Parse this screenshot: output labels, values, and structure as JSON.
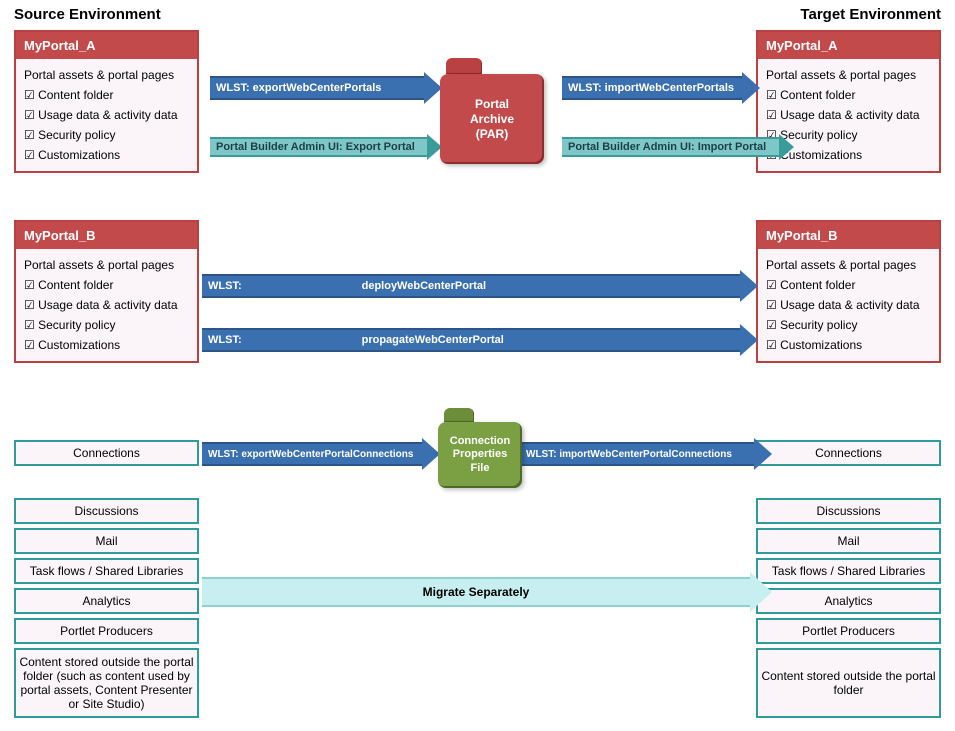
{
  "titles": {
    "source": "Source Environment",
    "target": "Target Environment"
  },
  "portals": {
    "a": {
      "name": "MyPortal_A",
      "items": [
        "Portal assets & portal pages",
        "☑ Content folder",
        "☑ Usage data & activity data",
        "☑ Security policy",
        "☑ Customizations"
      ]
    },
    "b": {
      "name": "MyPortal_B",
      "items": [
        "Portal assets & portal pages",
        "☑ Content folder",
        "☑ Usage data & activity data",
        "☑ Security policy",
        "☑ Customizations"
      ]
    }
  },
  "arrows": {
    "exportPortals": "WLST: exportWebCenterPortals",
    "importPortals": "WLST: importWebCenterPortals",
    "exportUI": "Portal Builder Admin UI: Export Portal",
    "importUI": "Portal Builder Admin UI: Import Portal",
    "deploy_prefix": "WLST:",
    "deploy_cmd": "deployWebCenterPortal",
    "propagate_prefix": "WLST:",
    "propagate_cmd": "propagateWebCenterPortal",
    "exportConn": "WLST: exportWebCenterPortalConnections",
    "importConn": "WLST: importWebCenterPortalConnections",
    "migrate": "Migrate Separately"
  },
  "folders": {
    "par1": "Portal",
    "par2": "Archive",
    "par3": "(PAR)",
    "conn1": "Connection",
    "conn2": "Properties",
    "conn3": "File"
  },
  "tealBoxes": {
    "connections": "Connections",
    "discussions": "Discussions",
    "mail": "Mail",
    "taskflows": "Task flows / Shared Libraries",
    "analytics": "Analytics",
    "portlet": "Portlet Producers",
    "contentSrc": "Content stored outside the portal folder (such as content used by portal assets, Content Presenter or Site Studio)",
    "contentTgt": "Content stored outside the portal folder"
  }
}
